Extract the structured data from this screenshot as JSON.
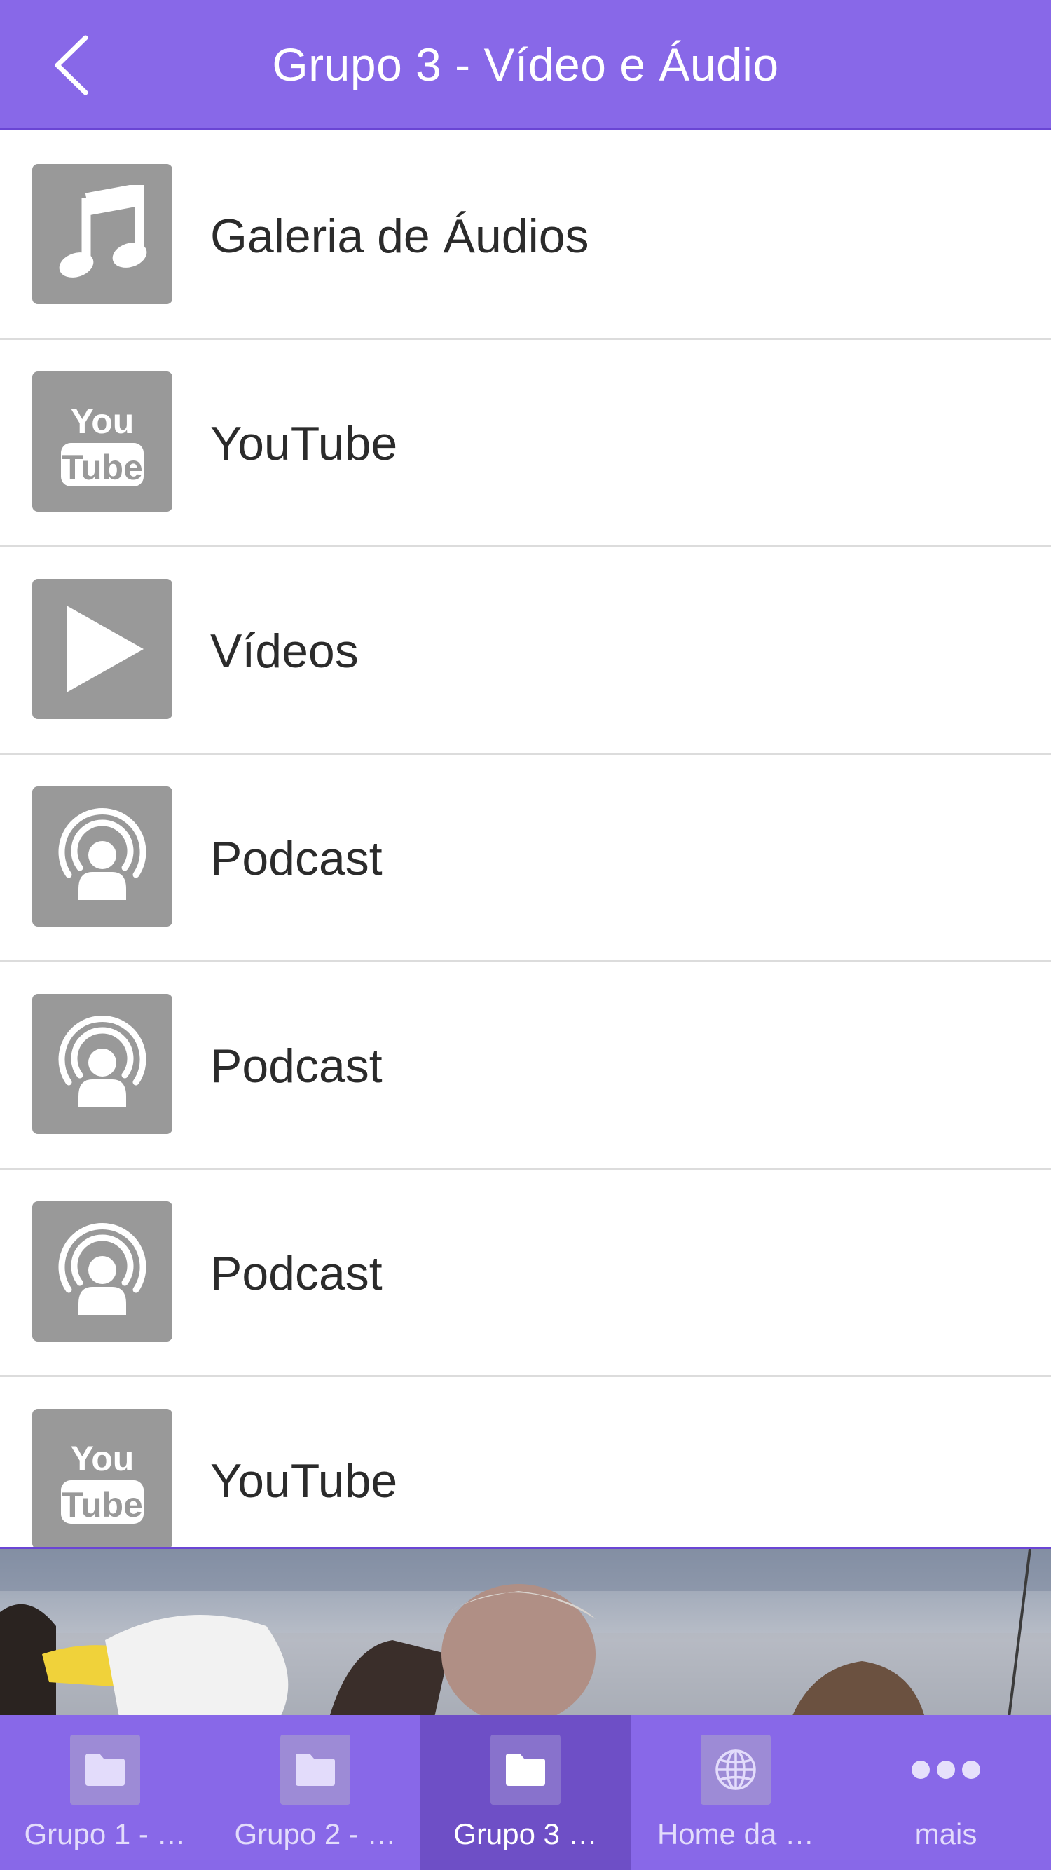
{
  "header": {
    "title": "Grupo 3 - Vídeo e Áudio",
    "back_icon": "chevron-left-icon",
    "background": "#8868e8"
  },
  "items": [
    {
      "label": "Galeria de Áudios",
      "icon": "music-note-icon"
    },
    {
      "label": "YouTube",
      "icon": "youtube-icon"
    },
    {
      "label": "Vídeos",
      "icon": "play-icon"
    },
    {
      "label": "Podcast",
      "icon": "podcast-icon"
    },
    {
      "label": "Podcast",
      "icon": "podcast-icon"
    },
    {
      "label": "Podcast",
      "icon": "podcast-icon"
    },
    {
      "label": "YouTube",
      "icon": "youtube-icon"
    }
  ],
  "youtube_icon_text": {
    "line1": "You",
    "line2": "Tube"
  },
  "tabs": [
    {
      "label": "Grupo 1 - …",
      "icon": "folder-icon",
      "active": false
    },
    {
      "label": "Grupo 2 - …",
      "icon": "folder-icon",
      "active": false
    },
    {
      "label": "Grupo 3 …",
      "icon": "folder-icon",
      "active": true
    },
    {
      "label": "Home da …",
      "icon": "globe-icon",
      "active": false
    },
    {
      "label": "mais",
      "icon": "more-dots-icon",
      "active": false
    }
  ],
  "colors": {
    "accent": "#8868e8",
    "active_tab": "#6e4fc6",
    "icon_tile": "#999999",
    "text": "#2b2b2b"
  }
}
